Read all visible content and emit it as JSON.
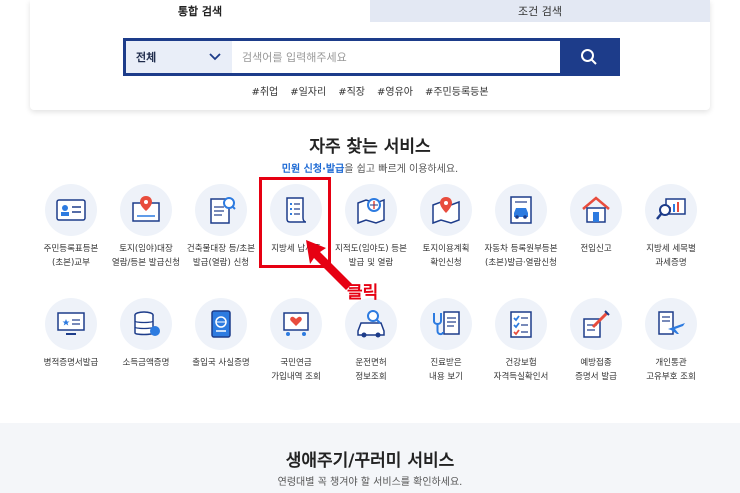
{
  "search": {
    "tabs": [
      {
        "label": "통합 검색",
        "active": true
      },
      {
        "label": "조건 검색",
        "active": false
      }
    ],
    "scope_label": "전체",
    "placeholder": "검색어를 입력해주세요",
    "tags": [
      "#취업",
      "#일자리",
      "#직장",
      "#영유아",
      "#주민등록등본"
    ]
  },
  "frequent": {
    "title": "자주 찾는 서비스",
    "subtitle_highlight": "민원 신청·발급",
    "subtitle_rest": "을 쉽고 빠르게 이용하세요.",
    "services": [
      {
        "label": "주민등록표등본\n(초본)교부",
        "icon": "id-card-icon"
      },
      {
        "label": "토지(임야)대장\n열람/등본 발급신청",
        "icon": "land-map-pin-icon"
      },
      {
        "label": "건축물대장 등/초본\n발급(열람) 신청",
        "icon": "document-search-icon"
      },
      {
        "label": "지방세 납세증",
        "icon": "tax-document-list-icon"
      },
      {
        "label": "지적도(임야도) 등본\n발급 및 열람",
        "icon": "cadastral-map-icon"
      },
      {
        "label": "토지이용계획\n확인신청",
        "icon": "map-pin-icon"
      },
      {
        "label": "자동차 등록원부등본\n(초본)발급·열람신청",
        "icon": "car-document-icon"
      },
      {
        "label": "전입신고",
        "icon": "house-icon"
      },
      {
        "label": "지방세 세목별\n과세증명",
        "icon": "chart-magnifier-icon"
      },
      {
        "label": "병적증명서발급",
        "icon": "monitor-star-icon"
      },
      {
        "label": "소득금액증명",
        "icon": "coin-stack-icon"
      },
      {
        "label": "출입국 사실증명",
        "icon": "passport-icon"
      },
      {
        "label": "국민연금\n가입내역 조회",
        "icon": "pension-heart-icon"
      },
      {
        "label": "운전면허\n정보조회",
        "icon": "driver-car-icon"
      },
      {
        "label": "진료받은\n내용 보기",
        "icon": "stethoscope-clipboard-icon"
      },
      {
        "label": "건강보험\n자격득실확인서",
        "icon": "checklist-icon"
      },
      {
        "label": "예방접종\n증명서 발급",
        "icon": "syringe-icon"
      },
      {
        "label": "개인통관\n고유부호 조회",
        "icon": "airplane-receipt-icon"
      }
    ]
  },
  "annotation": {
    "click_text": "클릭",
    "color": "#e60012"
  },
  "lifecycle": {
    "title": "생애주기/꾸러미 서비스",
    "subtitle": "연령대별 꼭 챙겨야 할 서비스를 확인하세요."
  },
  "colors": {
    "primary": "#1d3c8a",
    "accent": "#1c69d4",
    "annotation_red": "#e60012"
  }
}
